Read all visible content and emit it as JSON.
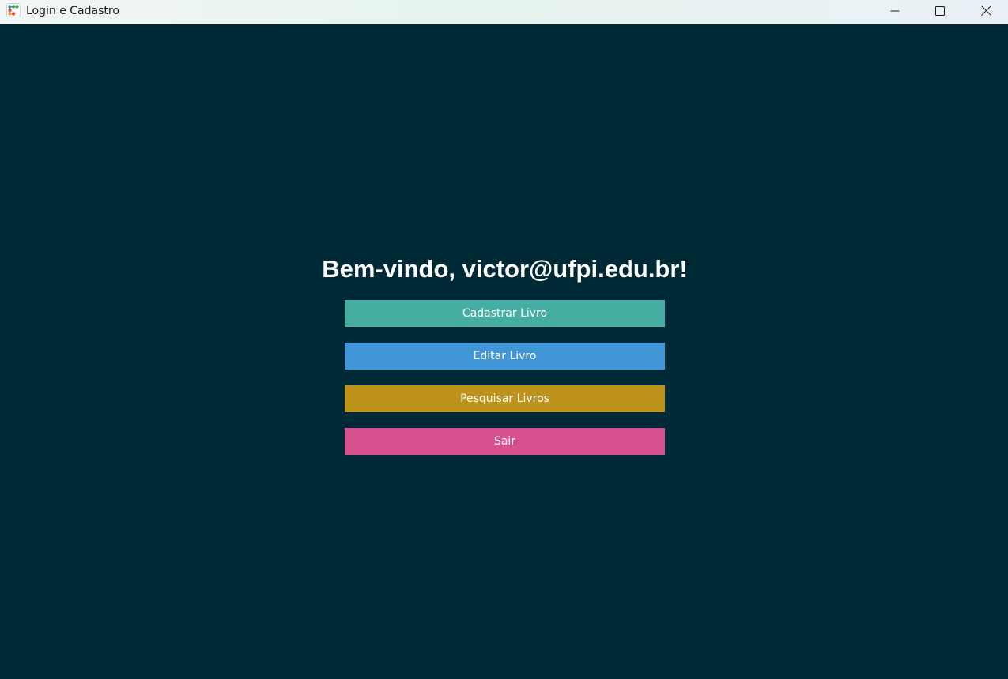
{
  "window": {
    "title": "Login e Cadastro",
    "icon": "app-logo-icon",
    "controls": {
      "minimize_icon": "minimize-icon",
      "maximize_icon": "maximize-icon",
      "close_icon": "close-icon"
    }
  },
  "main": {
    "welcome_text": "Bem-vindo, victor@ufpi.edu.br!",
    "background_color": "#002936",
    "buttons": [
      {
        "label": "Cadastrar Livro",
        "color": "#46ada3"
      },
      {
        "label": "Editar Livro",
        "color": "#4196d8"
      },
      {
        "label": "Pesquisar Livros",
        "color": "#bd931c"
      },
      {
        "label": "Sair",
        "color": "#d8518f"
      }
    ]
  }
}
